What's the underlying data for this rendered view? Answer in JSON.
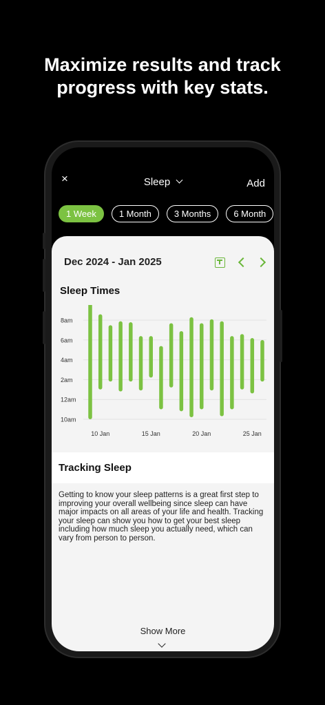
{
  "headline": {
    "line1": "Maximize results and track",
    "line2": "progress with key stats."
  },
  "topbar": {
    "close_label": "×",
    "title": "Sleep",
    "add_label": "Add"
  },
  "range_tabs": [
    "1 Week",
    "1 Month",
    "3 Months",
    "6 Month"
  ],
  "active_range_tab": "1 Week",
  "panel": {
    "date_range": "Dec 2024 - Jan 2025",
    "section_title": "Sleep Times",
    "tracking_title": "Tracking Sleep",
    "tracking_text": "Getting to know your sleep patterns is a great first step to improving your overall wellbeing since sleep can have major impacts on all areas of your life and health. Tracking your sleep can show you how to get your best sleep including how much sleep you actually need, which can vary from person to person.",
    "show_more": "Show More"
  },
  "colors": {
    "accent": "#7cc242",
    "background": "#000000",
    "panel": "#f4f4f4"
  },
  "icons": {
    "close": "close-icon",
    "title_dropdown": "chevron-down-icon",
    "calendar": "calendar-today-icon",
    "prev": "chevron-left-icon",
    "next": "chevron-right-icon",
    "show_more": "chevron-down-icon"
  },
  "chart_data": {
    "type": "bar",
    "title": "Sleep Times",
    "ytick_labels": [
      "8am",
      "6am",
      "4am",
      "2am",
      "12am",
      "10am"
    ],
    "xtick_labels": [
      "10 Jan",
      "15 Jan",
      "20 Jan",
      "25 Jan"
    ],
    "y_unit": "hours relative to midnight (12am = 0, 10pm previous day = -2)",
    "ylim": [
      -2,
      8
    ],
    "grid": true,
    "legend": "none",
    "categories": [
      "9 Jan",
      "10 Jan",
      "11 Jan",
      "12 Jan",
      "13 Jan",
      "14 Jan",
      "15 Jan",
      "16 Jan",
      "17 Jan",
      "18 Jan",
      "19 Jan",
      "20 Jan",
      "21 Jan",
      "22 Jan",
      "23 Jan",
      "24 Jan",
      "25 Jan",
      "26 Jan"
    ],
    "series": [
      {
        "bed_time": [
          -1.8,
          1.2,
          2.0,
          1.0,
          2.0,
          1.1,
          2.4,
          -0.8,
          1.4,
          -1.0,
          -1.6,
          -0.8,
          1.1,
          -1.5,
          -0.8,
          1.2,
          0.8,
          2.0
        ],
        "wake_time": [
          10.0,
          8.4,
          7.3,
          7.7,
          7.6,
          6.2,
          6.2,
          5.2,
          7.5,
          6.7,
          8.1,
          7.5,
          7.9,
          7.7,
          6.2,
          6.4,
          6.0,
          5.8
        ]
      }
    ]
  }
}
